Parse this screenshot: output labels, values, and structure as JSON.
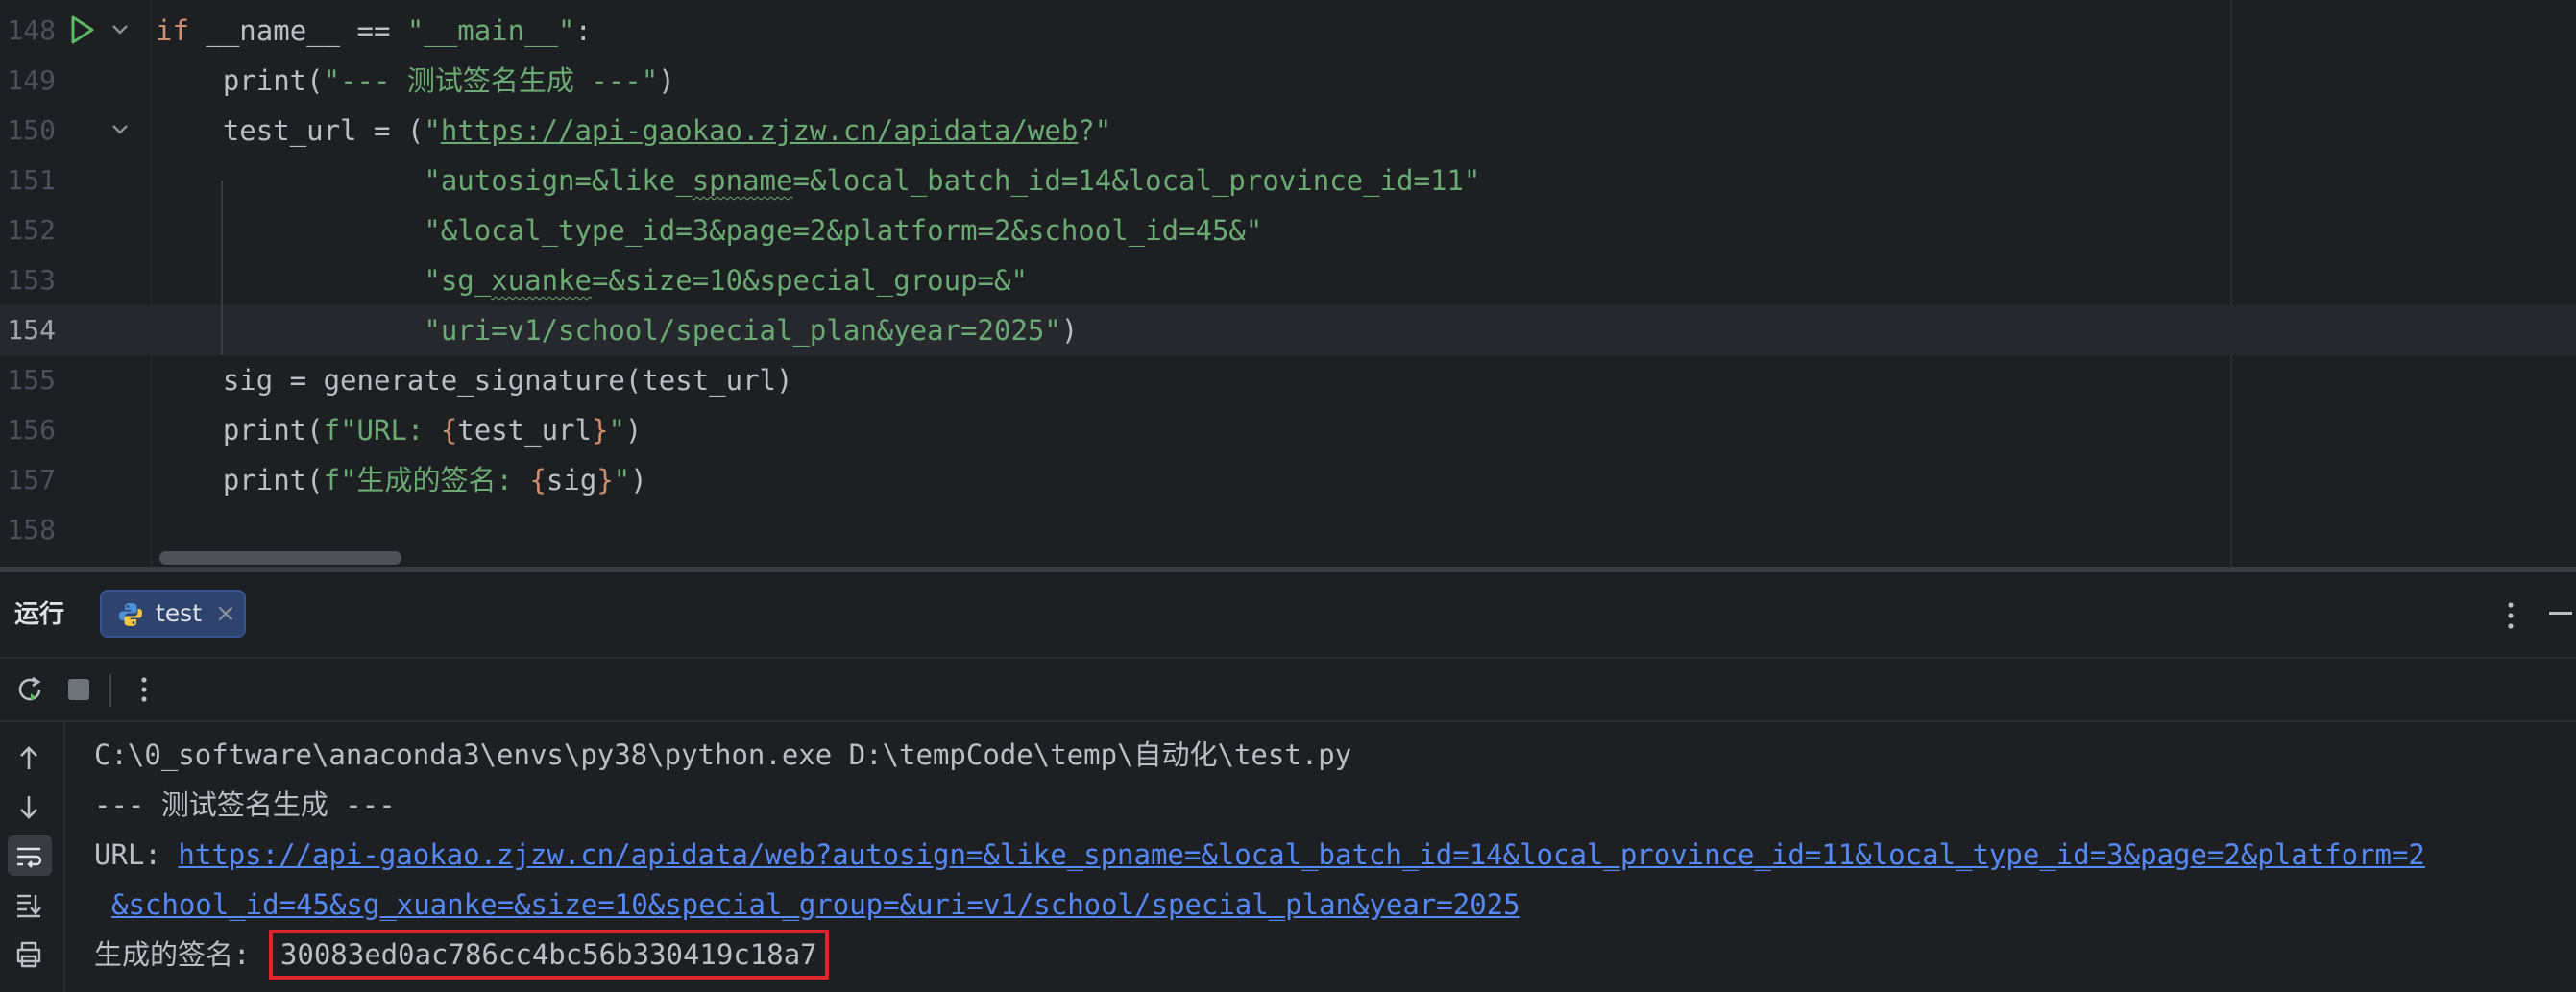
{
  "editor": {
    "lines": [
      {
        "num": "148",
        "segments": [
          {
            "t": "if ",
            "c": "kw"
          },
          {
            "t": "__name__ == ",
            "c": ""
          },
          {
            "t": "\"__main__\"",
            "c": "str"
          },
          {
            "t": ":",
            "c": ""
          }
        ]
      },
      {
        "num": "149",
        "segments": [
          {
            "t": "    print(",
            "c": ""
          },
          {
            "t": "\"--- 测试签名生成 ---\"",
            "c": "str"
          },
          {
            "t": ")",
            "c": ""
          }
        ]
      },
      {
        "num": "150",
        "segments": [
          {
            "t": "    test_url = (",
            "c": ""
          },
          {
            "t": "\"",
            "c": "str"
          },
          {
            "t": "https://api-gaokao.zjzw.cn/apidata/web",
            "c": "url"
          },
          {
            "t": "?\"",
            "c": "str"
          }
        ]
      },
      {
        "num": "151",
        "segments": [
          {
            "t": "                ",
            "c": ""
          },
          {
            "t": "\"autosign=&like_",
            "c": "str"
          },
          {
            "t": "spname",
            "c": "str wavy"
          },
          {
            "t": "=&local_batch_id=14&local_province_id=11\"",
            "c": "str"
          }
        ]
      },
      {
        "num": "152",
        "segments": [
          {
            "t": "                ",
            "c": ""
          },
          {
            "t": "\"&local_type_id=3&page=2&platform=2&school_id=45&\"",
            "c": "str"
          }
        ]
      },
      {
        "num": "153",
        "segments": [
          {
            "t": "                ",
            "c": ""
          },
          {
            "t": "\"sg_",
            "c": "str"
          },
          {
            "t": "xuanke",
            "c": "str wavy"
          },
          {
            "t": "=&size=10&special_group=&\"",
            "c": "str"
          }
        ]
      },
      {
        "num": "154",
        "segments": [
          {
            "t": "                ",
            "c": ""
          },
          {
            "t": "\"uri=v1/school/special_plan&year=2025\"",
            "c": "str"
          },
          {
            "t": ")",
            "c": ""
          }
        ]
      },
      {
        "num": "155",
        "segments": [
          {
            "t": "    sig = generate_signature(test_url)",
            "c": ""
          }
        ]
      },
      {
        "num": "156",
        "segments": [
          {
            "t": "    print(",
            "c": ""
          },
          {
            "t": "f\"URL: ",
            "c": "str"
          },
          {
            "t": "{",
            "c": "brace"
          },
          {
            "t": "test_url",
            "c": ""
          },
          {
            "t": "}",
            "c": "brace"
          },
          {
            "t": "\"",
            "c": "str"
          },
          {
            "t": ")",
            "c": ""
          }
        ]
      },
      {
        "num": "157",
        "segments": [
          {
            "t": "    print(",
            "c": ""
          },
          {
            "t": "f\"生成的签名: ",
            "c": "str"
          },
          {
            "t": "{",
            "c": "brace"
          },
          {
            "t": "sig",
            "c": ""
          },
          {
            "t": "}",
            "c": "brace"
          },
          {
            "t": "\"",
            "c": "str"
          },
          {
            "t": ")",
            "c": ""
          }
        ]
      },
      {
        "num": "158",
        "segments": []
      }
    ],
    "current_line": "154"
  },
  "run_window": {
    "title": "运行",
    "tab_label": "test",
    "tab_close": "×"
  },
  "console": {
    "command": "C:\\0_software\\anaconda3\\envs\\py38\\python.exe D:\\tempCode\\temp\\自动化\\test.py",
    "header": "--- 测试签名生成 ---",
    "url_label": "URL: ",
    "url_part1": "https://api-gaokao.zjzw.cn/apidata/web?autosign=&like_spname=&local_batch_id=14&local_province_id=11&local_type_id=3&page=2&platform=2",
    "url_part2": "&school_id=45&sg_xuanke=&size=10&special_group=&uri=v1/school/special_plan&year=2025",
    "sig_label": "生成的签名: ",
    "sig_value": "30083ed0ac786cc4bc56b330419c18a7"
  },
  "colors": {
    "keyword": "#cf8e6d",
    "string": "#6aab73",
    "link": "#548af7",
    "highlight_box": "#e0242c",
    "run_green": "#5fb865"
  }
}
